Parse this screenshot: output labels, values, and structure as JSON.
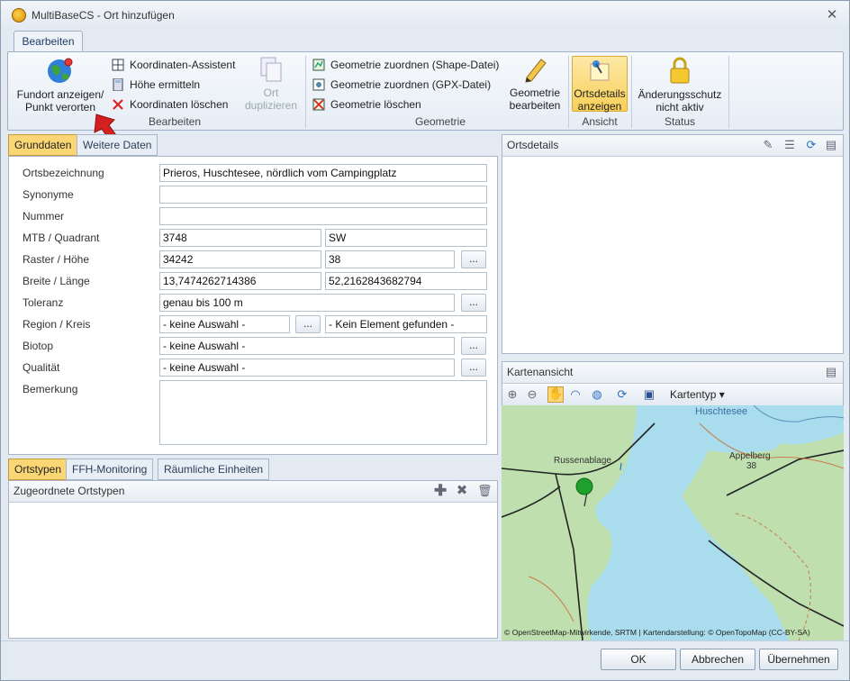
{
  "window": {
    "title": "MultiBaseCS - Ort hinzufügen",
    "close_glyph": "✕"
  },
  "ribbon": {
    "tab": "Bearbeiten",
    "fundort_btn_line1": "Fundort anzeigen/",
    "fundort_btn_line2": "Punkt verorten",
    "koord_assistent": "Koordinaten-Assistent",
    "hoehe_ermitteln": "Höhe ermitteln",
    "koord_loeschen": "Koordinaten löschen",
    "ort_duplizieren_line1": "Ort",
    "ort_duplizieren_line2": "duplizieren",
    "group_bearbeiten": "Bearbeiten",
    "geo_shape": "Geometrie zuordnen (Shape-Datei)",
    "geo_gpx": "Geometrie zuordnen (GPX-Datei)",
    "geo_loeschen": "Geometrie löschen",
    "geo_bearbeiten_line1": "Geometrie",
    "geo_bearbeiten_line2": "bearbeiten",
    "group_geometrie": "Geometrie",
    "ortsdetails_line1": "Ortsdetails",
    "ortsdetails_line2": "anzeigen",
    "group_ansicht": "Ansicht",
    "aenderungsschutz_line1": "Änderungsschutz",
    "aenderungsschutz_line2": "nicht aktiv",
    "group_status": "Status"
  },
  "form": {
    "tab_grunddaten": "Grunddaten",
    "tab_weitere": "Weitere Daten",
    "dots": "...",
    "labels": {
      "ortsbezeichnung": "Ortsbezeichnung",
      "synonyme": "Synonyme",
      "nummer": "Nummer",
      "mtb": "MTB / Quadrant",
      "raster": "Raster / Höhe",
      "breite": "Breite / Länge",
      "toleranz": "Toleranz",
      "region": "Region / Kreis",
      "biotop": "Biotop",
      "qualitaet": "Qualität",
      "bemerkung": "Bemerkung"
    },
    "values": {
      "ortsbezeichnung": "Prieros, Huschtesee, nördlich vom Campingplatz",
      "synonyme": "",
      "nummer": "",
      "mtb": "3748",
      "quadrant": "SW",
      "raster": "34242",
      "hoehe": "38",
      "breite": "13,7474262714386",
      "laenge": "52,2162843682794",
      "toleranz": "genau bis 100 m",
      "region": "- keine Auswahl -",
      "kreis": "- Kein Element gefunden -",
      "biotop": "- keine Auswahl -",
      "qualitaet": "- keine Auswahl -",
      "bemerkung": ""
    }
  },
  "lower": {
    "tab_ortstypen": "Ortstypen",
    "tab_ffh": "FFH-Monitoring",
    "tab_raeumlich": "Räumliche Einheiten",
    "header": "Zugeordnete Ortstypen"
  },
  "ortsdetails": {
    "title": "Ortsdetails"
  },
  "karte": {
    "title": "Kartenansicht",
    "kartentyp": "Kartentyp",
    "labels": {
      "huschtesee": "Huschtesee",
      "russenablage": "Russenablage",
      "appelberg": "Appelberg",
      "appelberg_height": "38"
    },
    "attribution": "© OpenStreetMap-Mitwirkende, SRTM | Kartendarstellung: © OpenTopoMap (CC-BY-SA)"
  },
  "dialog": {
    "ok": "OK",
    "abbrechen": "Abbrechen",
    "uebernehmen": "Übernehmen"
  },
  "colors": {
    "accent": "#fbd674",
    "water": "#a9dcec",
    "land": "#bfe0ae",
    "arrow": "#d42020",
    "marker": "#1fa02c"
  }
}
